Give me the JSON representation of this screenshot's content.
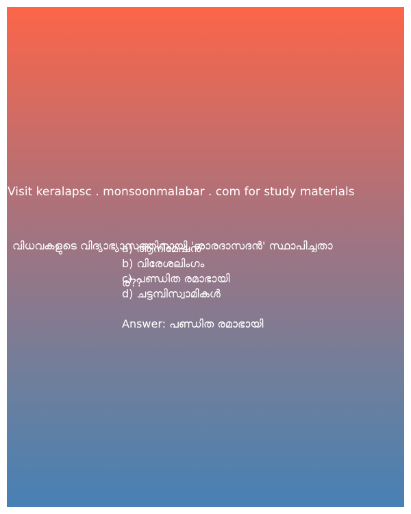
{
  "promo": {
    "text": "Visit keralapsc . monsoonmalabar . com for study materials"
  },
  "question": {
    "line1": "വിധവകളുടെ വിദ്യാഭ്യാസത്തിനായി 'ശാരദാസദന്‍' സ്ഥാപിച്ചതാ",
    "line2": "ര്??"
  },
  "options": [
    "a) ആനിമേഷന്‍",
    "b) വിരേശലിംഗം",
    "c) പണ്ഡിത രമാഭായി",
    "d) ചട്ടമ്പിസ്വാമികള്‍"
  ],
  "answer": {
    "text": "Answer: പണ്ഡിത രമാഭായി"
  },
  "colors": {
    "gradient_top": "#fc6549",
    "gradient_bottom": "#4780b5",
    "text": "#ffffff"
  }
}
